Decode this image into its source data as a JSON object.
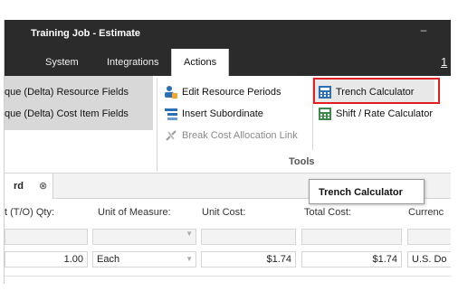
{
  "window": {
    "title": "Training Job - Estimate",
    "minimize_glyph": "–",
    "help_glyph": "1"
  },
  "menu": {
    "items": [
      "System",
      "Integrations"
    ],
    "active": "Actions"
  },
  "ribbon": {
    "left_group": {
      "items": [
        "que (Delta) Resource Fields",
        "que (Delta) Cost Item Fields"
      ]
    },
    "middle_group": {
      "items": [
        {
          "label": "Edit Resource Periods",
          "icon": "resource-periods-icon",
          "enabled": true
        },
        {
          "label": "Insert Subordinate",
          "icon": "insert-subordinate-icon",
          "enabled": true
        },
        {
          "label": "Break Cost Allocation Link",
          "icon": "break-link-icon",
          "enabled": false
        }
      ]
    },
    "right_group": {
      "items": [
        {
          "label": "Trench Calculator",
          "icon": "trench-calculator-icon",
          "highlighted": true
        },
        {
          "label": "Shift / Rate Calculator",
          "icon": "shift-rate-calculator-icon"
        }
      ]
    },
    "group_label": "Tools"
  },
  "tabs": {
    "doc_tab_label": "rd",
    "close_glyph": "⊗"
  },
  "tooltip": {
    "text": "Trench Calculator"
  },
  "grid": {
    "columns": [
      "t (T/O) Qty:",
      "Unit of Measure:",
      "Unit Cost:",
      "Total Cost:",
      "Currenc"
    ],
    "row": {
      "qty": "1.00",
      "unit": "Each",
      "unit_cost": "$1.74",
      "total_cost": "$1.74",
      "currency": "U.S. Do"
    }
  },
  "colors": {
    "titlebar": "#2b2b2b",
    "highlight_border": "#e02020",
    "ribbon_group_bg": "#d8d8d8"
  }
}
